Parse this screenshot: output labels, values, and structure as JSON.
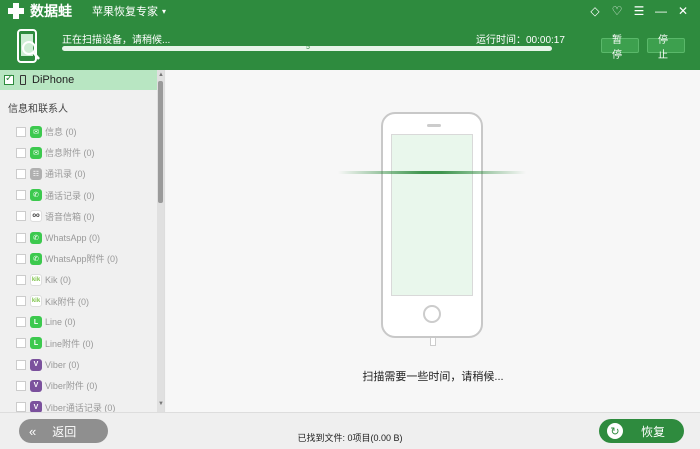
{
  "app": {
    "name": "数据蛙",
    "product": "苹果恢复专家",
    "colors": {
      "primary": "#2e8b3e",
      "selected": "#b8e6c2",
      "button_gray": "#8f8f8f"
    }
  },
  "window_controls": {
    "diamond_icon": "◇",
    "chat_icon": "♡",
    "menu_icon": "☰",
    "minimize_icon": "—",
    "close_icon": "✕"
  },
  "scan": {
    "status": "正在扫描设备，请稍候...",
    "runtime": "运行时间：00:00:17",
    "progress_percent": 100,
    "progress_label": "5",
    "pause_label": "暂停",
    "stop_label": "停止",
    "message": "扫描需要一些时间，请稍候..."
  },
  "sidebar": {
    "device": "DiPhone",
    "section": "信息和联系人",
    "items": [
      {
        "label": "信息 (0)",
        "icon": "messages-icon",
        "color": "#3cc94e",
        "glyph": "✉"
      },
      {
        "label": "信息附件 (0)",
        "icon": "message-attachment-icon",
        "color": "#3cc94e",
        "glyph": "✉"
      },
      {
        "label": "通讯录 (0)",
        "icon": "contacts-icon",
        "color": "#b0b0b0",
        "glyph": "☷"
      },
      {
        "label": "通话记录 (0)",
        "icon": "phone-icon",
        "color": "#3cc94e",
        "glyph": "✆"
      },
      {
        "label": "语音信箱 (0)",
        "icon": "voicemail-icon",
        "color": "#ffffff",
        "glyph": "oo"
      },
      {
        "label": "WhatsApp (0)",
        "icon": "whatsapp-icon",
        "color": "#3cc94e",
        "glyph": "✆"
      },
      {
        "label": "WhatsApp附件 (0)",
        "icon": "whatsapp-attachment-icon",
        "color": "#3cc94e",
        "glyph": "✆"
      },
      {
        "label": "Kik (0)",
        "icon": "kik-icon",
        "color": "#ffffff",
        "glyph": "kik"
      },
      {
        "label": "Kik附件 (0)",
        "icon": "kik-attachment-icon",
        "color": "#ffffff",
        "glyph": "kik"
      },
      {
        "label": "Line (0)",
        "icon": "line-icon",
        "color": "#3cc94e",
        "glyph": "L"
      },
      {
        "label": "Line附件 (0)",
        "icon": "line-attachment-icon",
        "color": "#3cc94e",
        "glyph": "L"
      },
      {
        "label": "Viber (0)",
        "icon": "viber-icon",
        "color": "#7b519d",
        "glyph": "V"
      },
      {
        "label": "Viber附件 (0)",
        "icon": "viber-attachment-icon",
        "color": "#7b519d",
        "glyph": "V"
      },
      {
        "label": "Viber通话记录 (0)",
        "icon": "viber-calls-icon",
        "color": "#7b519d",
        "glyph": "V"
      }
    ]
  },
  "footer": {
    "back_label": "返回",
    "found": "已找到文件: 0项目(0.00 B)",
    "restore_label": "恢复"
  }
}
